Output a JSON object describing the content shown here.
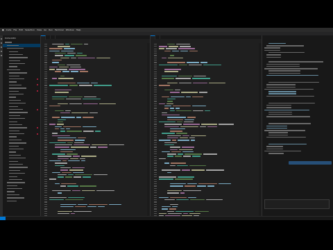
{
  "menubar": {
    "items": [
      "Code",
      "File",
      "Edit",
      "Selection",
      "View",
      "Go",
      "Run",
      "Terminal",
      "Window",
      "Help"
    ],
    "clock": ""
  },
  "window_title": "",
  "explorer": {
    "header": "EXPLORER",
    "rows": [
      "",
      "",
      "",
      "",
      "",
      "",
      "",
      "",
      "",
      "",
      "",
      "",
      "",
      "",
      "",
      "",
      "",
      "",
      "",
      "",
      "",
      "",
      "",
      "",
      "",
      "",
      "",
      "",
      "",
      "",
      "",
      "",
      "",
      "",
      "",
      "",
      "",
      "",
      "",
      "",
      "",
      "",
      "",
      "",
      "",
      "",
      "",
      "",
      "",
      "",
      "",
      "",
      ""
    ]
  },
  "editor1": {
    "tabs": [
      "",
      "",
      ""
    ]
  },
  "editor2": {
    "tabs": [
      "",
      ""
    ]
  },
  "chat": {
    "header": "",
    "bubble": "",
    "input_placeholder": ""
  },
  "statusbar": {
    "left": "",
    "right": ""
  },
  "colors": {
    "accent": "#0078d4",
    "keyword": "#c586c0",
    "string": "#ce9178",
    "func": "#dcdcaa",
    "var": "#9cdcfe",
    "comment": "#6a9955",
    "type": "#4ec9b0",
    "plain": "#d4d4d4"
  }
}
